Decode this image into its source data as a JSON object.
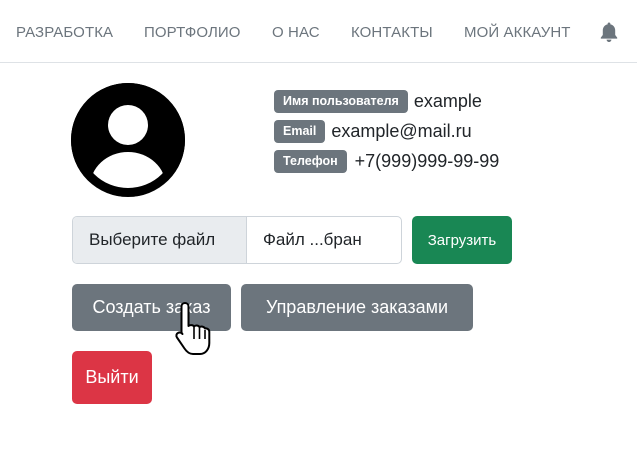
{
  "nav": {
    "items": [
      {
        "label": "РАЗРАБОТКА"
      },
      {
        "label": "ПОРТФОЛИО"
      },
      {
        "label": "О НАС"
      },
      {
        "label": "КОНТАКТЫ"
      },
      {
        "label": "МОЙ АККАУНТ"
      }
    ],
    "bell_icon": "bell-icon"
  },
  "profile": {
    "avatar_icon": "user-avatar-icon",
    "fields": [
      {
        "label": "Имя пользователя",
        "value": "example"
      },
      {
        "label": "Email",
        "value": "example@mail.ru"
      },
      {
        "label": "Телефон",
        "value": "+7(999)999-99-99"
      }
    ]
  },
  "upload": {
    "choose_label": "Выберите файл",
    "file_name": "Файл ...бран",
    "upload_button": "Загрузить"
  },
  "actions": {
    "create_order": "Создать заказ",
    "manage_orders": "Управление заказами",
    "logout": "Выйти"
  },
  "colors": {
    "secondary": "#6c757d",
    "success": "#198754",
    "danger": "#dc3545",
    "border": "#dee2e6"
  },
  "cursor_icon": "hand-pointer-icon"
}
